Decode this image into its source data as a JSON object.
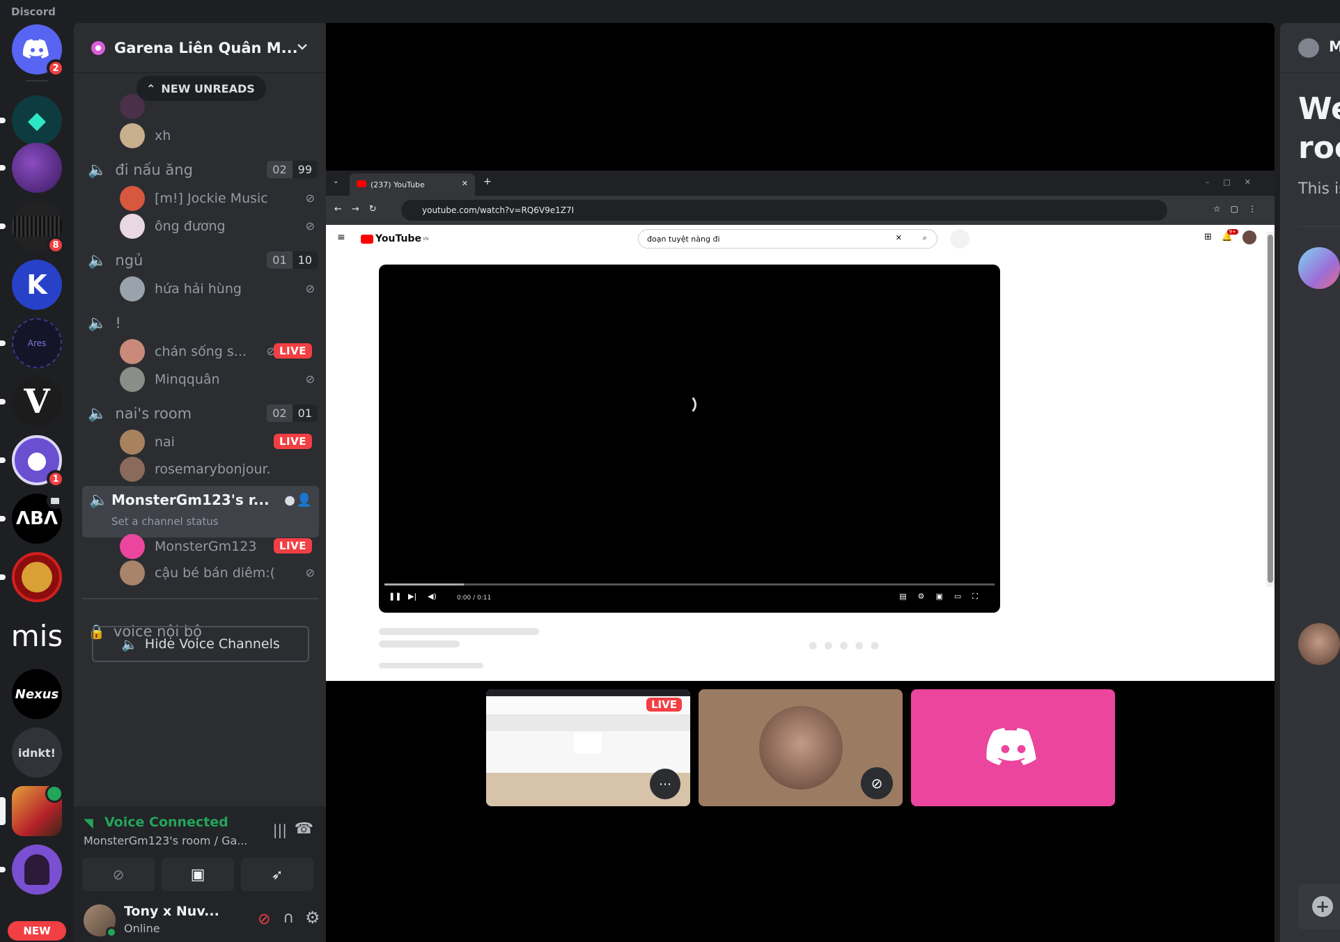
{
  "app": {
    "title": "Discord"
  },
  "servers": [
    {
      "name": "Direct Messages",
      "badge": "2"
    },
    {
      "name": "server-2"
    },
    {
      "name": "server-3"
    },
    {
      "name": "server-4",
      "badge": "8"
    },
    {
      "name": "server-5"
    },
    {
      "name": "Ares",
      "label": "Ares"
    },
    {
      "name": "V",
      "label": "V"
    },
    {
      "name": "server-8",
      "badge": "1"
    },
    {
      "name": "ABA",
      "label": "ΛBΛ"
    },
    {
      "name": "server-10"
    },
    {
      "name": "mis",
      "label": "mis"
    },
    {
      "name": "Nexus",
      "label": "Nexus"
    },
    {
      "name": "idnkt",
      "label": "idnkt!"
    },
    {
      "name": "Garena Liên Quân"
    },
    {
      "name": "server-15"
    }
  ],
  "new_pill": "NEW",
  "guild": {
    "name": "Garena Liên Quân M...",
    "new_unreads": "NEW UNREADS"
  },
  "channels": {
    "top_user": "xh",
    "di_nau_ang": {
      "name": "đi nấu ăng",
      "count_a": "02",
      "count_b": "99",
      "users": [
        "[m!] Jockie Music",
        "ông đương"
      ]
    },
    "ngu": {
      "name": "ngủ",
      "count_a": "01",
      "count_b": "10",
      "users": [
        "hứa hải hùng"
      ]
    },
    "bang": {
      "name": "!",
      "users": [
        "chán sống s...",
        "Minqquân"
      ]
    },
    "nais_room": {
      "name": "nai's room",
      "count_a": "02",
      "count_b": "01",
      "users": [
        "nai",
        "rosemarybonjour."
      ]
    },
    "monster": {
      "name": "MonsterGm123's r...",
      "status": "Set a channel status",
      "users": [
        "MonsterGm123",
        "cậu bé bán diêm:("
      ]
    },
    "locked": {
      "name": "voice nội bộ"
    },
    "hide_label": "Hide Voice Channels"
  },
  "live_label": "LIVE",
  "voice": {
    "status": "Voice Connected",
    "location": "MonsterGm123's room / Ga..."
  },
  "user": {
    "name": "Tony x Nuv...",
    "status": "Online"
  },
  "browser": {
    "tab_title": "(237) YouTube",
    "url": "youtube.com/watch?v=RQ6V9e1Z7I",
    "yt_logo": "YouTube",
    "yt_region": "VN",
    "search_query": "đoạn tuyệt nàng đi",
    "notif_count": "9+",
    "time": "0:00 / 0:11"
  },
  "right_panel": {
    "header_initial": "M",
    "line1": "We",
    "line2": "roo",
    "line3": "This is"
  },
  "colors": {
    "accent": "#5865f2",
    "live": "#f23f43",
    "online": "#23a55a",
    "tile_pink": "#eb459e"
  }
}
